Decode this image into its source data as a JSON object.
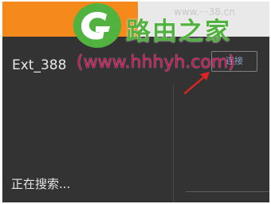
{
  "header": {
    "url_partial": "www.···38.cn"
  },
  "device": {
    "name": "Ext_388"
  },
  "connect_button": {
    "label": "连接"
  },
  "status": {
    "text": "正在搜索..."
  },
  "watermark": {
    "title": "路由之家",
    "url": "(www.hhhyh.com)"
  },
  "colors": {
    "orange": "#f5891c",
    "panel": "#333333",
    "watermark_green": "#51b23f",
    "watermark_red": "#c8165a",
    "arrow_red": "#e02424"
  }
}
